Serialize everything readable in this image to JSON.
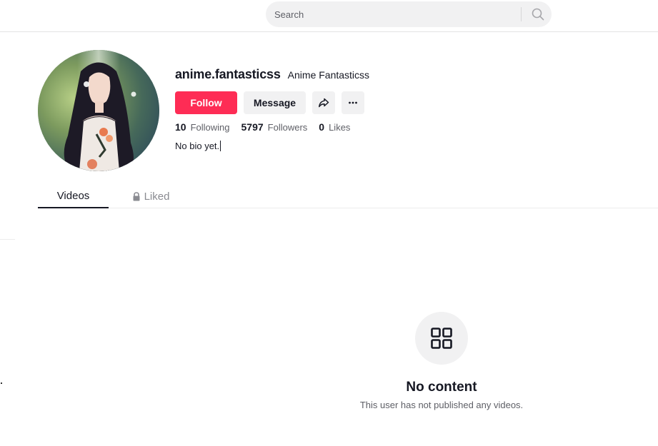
{
  "header": {
    "search": {
      "placeholder": "Search",
      "value": "",
      "icon": "search-icon"
    }
  },
  "profile": {
    "username": "anime.fantasticss",
    "nickname": "Anime Fantasticss",
    "avatar": "anime-girl-avatar",
    "buttons": {
      "follow": "Follow",
      "message": "Message",
      "share_icon": "share-icon",
      "more_icon": "more-icon"
    },
    "stats": [
      {
        "value": "10",
        "label": "Following"
      },
      {
        "value": "5797",
        "label": "Followers"
      },
      {
        "value": "0",
        "label": "Likes"
      }
    ],
    "bio": "No bio yet."
  },
  "tabs": [
    {
      "label": "Videos",
      "active": true
    },
    {
      "label": "Liked",
      "active": false,
      "icon": "lock-icon"
    }
  ],
  "empty_state": {
    "icon": "grid-icon",
    "title": "No content",
    "description": "This user has not published any videos."
  },
  "colors": {
    "accent": "#fe2c55",
    "button_gray": "#f1f1f2",
    "text_primary": "#161823",
    "text_secondary": "#5e5f66"
  }
}
